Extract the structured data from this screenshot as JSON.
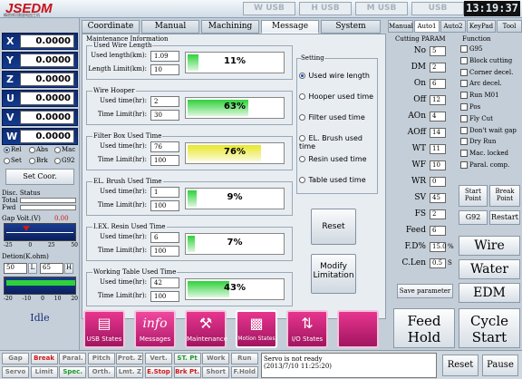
{
  "header": {
    "logo": "JSEDM",
    "logo_sub": "精密线切割放电加工机",
    "usb": [
      "W USB",
      "H USB",
      "M USB",
      "USB"
    ],
    "clock": "13:19:37"
  },
  "axes": [
    {
      "name": "X",
      "value": "0.0000"
    },
    {
      "name": "Y",
      "value": "0.0000"
    },
    {
      "name": "Z",
      "value": "0.0000"
    },
    {
      "name": "U",
      "value": "0.0000"
    },
    {
      "name": "V",
      "value": "0.0000"
    },
    {
      "name": "W",
      "value": "0.0000"
    }
  ],
  "coord_modes": {
    "row1": [
      "Rel",
      "Abs",
      "Mac"
    ],
    "row2": [
      "Set",
      "Brk",
      "G92"
    ],
    "selected": "Rel"
  },
  "set_coor": "Set Coor.",
  "disc_status": {
    "title": "Disc. Status",
    "total_label": "Total",
    "fwd_label": "Fwd"
  },
  "gap_volt": {
    "title": "Gap Volt.(V)",
    "value": "0.00",
    "scale": [
      "-25",
      "0",
      "25",
      "50"
    ]
  },
  "detion": {
    "title": "Detion(K.ohm)",
    "low": "50",
    "low_btn": "L",
    "high": "65",
    "high_btn": "H",
    "scale": [
      "-20",
      "-10",
      "0",
      "10",
      "20"
    ]
  },
  "state": "Idle",
  "tabs": [
    "Coordinate",
    "Manual",
    "Machining",
    "Message",
    "System"
  ],
  "active_tab": "Message",
  "maintenance": {
    "title": "Maintenance Information",
    "groups": [
      {
        "title": "Used Wire Length",
        "l1": "Used length(km):",
        "v1": "1.09",
        "l2": "Length Limit(km):",
        "v2": "10",
        "pct": "11%",
        "fill": 0.11,
        "color": "#2fd13a"
      },
      {
        "title": "Wire Hooper",
        "l1": "Used time(hr):",
        "v1": "2",
        "l2": "Time Limit(hr):",
        "v2": "30",
        "pct": "63%",
        "fill": 0.63,
        "color": "#2fd13a"
      },
      {
        "title": "Filter Box Used Time",
        "l1": "Used time(hr):",
        "v1": "76",
        "l2": "Time Limit(hr):",
        "v2": "100",
        "pct": "76%",
        "fill": 0.76,
        "color": "#e8e62a"
      },
      {
        "title": "EL. Brush Used Time",
        "l1": "Used time(hr):",
        "v1": "1",
        "l2": "Time Limit(hr):",
        "v2": "100",
        "pct": "9%",
        "fill": 0.09,
        "color": "#2fd13a"
      },
      {
        "title": "I.EX. Resin Used Time",
        "l1": "Used time(hr):",
        "v1": "6",
        "l2": "Time Limit(hr):",
        "v2": "100",
        "pct": "7%",
        "fill": 0.07,
        "color": "#2fd13a"
      },
      {
        "title": "Working Table Used Time",
        "l1": "Used time(hr):",
        "v1": "42",
        "l2": "Time Limit(hr):",
        "v2": "100",
        "pct": "43%",
        "fill": 0.43,
        "color": "#2fd13a"
      }
    ]
  },
  "setting": {
    "title": "Setting",
    "options": [
      "Used wire length",
      "Hooper used time",
      "Filter used time",
      "EL. Brush used time",
      "Resin used time",
      "Table used time"
    ],
    "selected": 0,
    "reset": "Reset",
    "modify": "Modify Limitation"
  },
  "menu_tiles": [
    "USB States",
    "Messages",
    "Maintenance",
    "Motion States",
    "I/O States"
  ],
  "right_tabs": [
    "Manual",
    "Auto1",
    "Auto2",
    "KeyPad",
    "Tool"
  ],
  "right_active": "Auto1",
  "cutting": {
    "title": "Cutting PARAM",
    "params": [
      {
        "n": "No",
        "v": "5"
      },
      {
        "n": "DM",
        "v": "2"
      },
      {
        "n": "On",
        "v": "6"
      },
      {
        "n": "Off",
        "v": "12"
      },
      {
        "n": "AOn",
        "v": "4"
      },
      {
        "n": "AOff",
        "v": "14"
      },
      {
        "n": "WT",
        "v": "11"
      },
      {
        "n": "WF",
        "v": "10"
      },
      {
        "n": "WR",
        "v": "0"
      },
      {
        "n": "SV",
        "v": "45"
      },
      {
        "n": "FS",
        "v": "2"
      },
      {
        "n": "Feed",
        "v": "6"
      },
      {
        "n": "F.D%",
        "v": "15.0"
      },
      {
        "n": "C.Len",
        "v": "0.5"
      }
    ],
    "fd_unit": "%",
    "clen_unit": "S",
    "save": "Save parameter"
  },
  "functions": {
    "title": "Function",
    "items": [
      "G95",
      "Block cutting",
      "Corner decel.",
      "Arc decel.",
      "Run M01",
      "Pos",
      "Fly Cut",
      "Don't wait gap",
      "Dry Run",
      "Mac. locked",
      "Paral. comp."
    ]
  },
  "right_buttons": {
    "start_point": "Start Point",
    "break_point": "Break Point",
    "g92": "G92",
    "restart": "Restart",
    "wire": "Wire",
    "water": "Water",
    "edm": "EDM",
    "feed_hold": "Feed Hold",
    "cycle_start": "Cycle Start"
  },
  "status_bar": {
    "row1": [
      "Gap",
      "Break",
      "Paral.",
      "Pitch",
      "Prot. Z",
      "Vert.",
      "ST. Pt",
      "Work",
      "Run"
    ],
    "row2": [
      "Servo",
      "Limit",
      "Spec.",
      "Orth.",
      "Lmt. Z",
      "E.Stop",
      "Brk Pt.",
      "Short",
      "F.Hold"
    ],
    "msg1": "Servo is not ready",
    "msg2": "(2013/7/10   11:25:20)",
    "reset": "Reset",
    "pause": "Pause"
  },
  "colors": {
    "red": "#d01818",
    "green": "#2fd13a",
    "magenta": "#c02278",
    "navy": "#0d2a72"
  }
}
